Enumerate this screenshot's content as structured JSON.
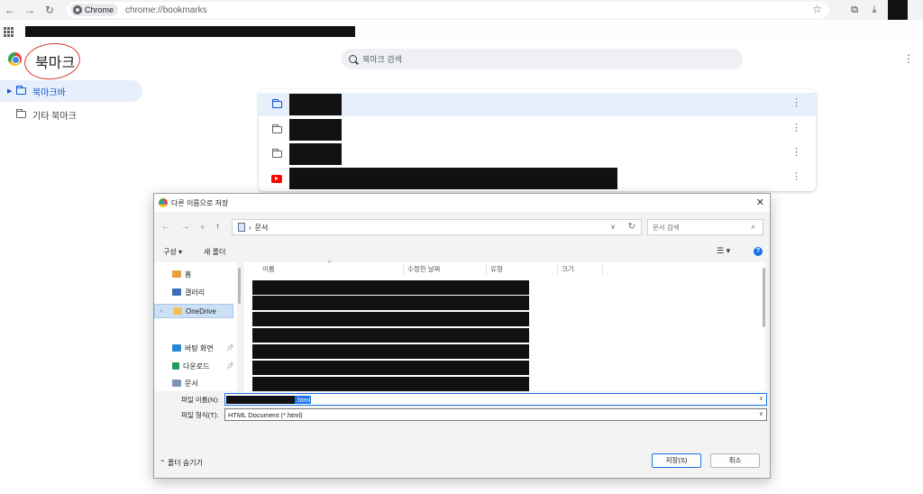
{
  "browser": {
    "chip_label": "Chrome",
    "url": "chrome://bookmarks"
  },
  "bookmarks_page": {
    "title": "북마크",
    "search_placeholder": "북마크 검색",
    "sidebar": [
      {
        "label": "북마크바",
        "active": true
      },
      {
        "label": "기타 북마크",
        "active": false
      }
    ],
    "list_rows": [
      {
        "type": "folder",
        "title_redacted": true
      },
      {
        "type": "folder",
        "title_redacted": true
      },
      {
        "type": "folder",
        "title_redacted": true
      },
      {
        "type": "youtube-link",
        "title_redacted": true
      }
    ]
  },
  "dialog": {
    "title": "다른 이름으로 저장",
    "address": "문서",
    "search_placeholder": "문서 검색",
    "commands": {
      "organize": "구성 ▾",
      "new_folder": "새 폴더"
    },
    "nav": [
      {
        "label": "홈",
        "icon": "home-icon"
      },
      {
        "label": "갤러리",
        "icon": "gallery-icon"
      },
      {
        "label": "OneDrive",
        "icon": "onedrive-folder-icon",
        "selected": true
      },
      {
        "label": "바탕 화면",
        "icon": "desktop-icon",
        "pinned": true
      },
      {
        "label": "다운로드",
        "icon": "download-icon",
        "pinned": true
      },
      {
        "label": "문서",
        "icon": "documents-icon",
        "pinned": true
      }
    ],
    "columns": [
      "이름",
      "수정한 날짜",
      "유형",
      "크기"
    ],
    "file_rows": 7,
    "filename_label": "파일 이름(N):",
    "filename_ext": ".html",
    "filetype_label": "파일 형식(T):",
    "filetype_value": "HTML Document (*.html)",
    "hide_folders": "폴더 숨기기",
    "save_button": "저장(S)",
    "cancel_button": "취소"
  },
  "colors": {
    "accent": "#0b57d0",
    "selection": "#e8effc",
    "annotation": "#d33a2c"
  }
}
